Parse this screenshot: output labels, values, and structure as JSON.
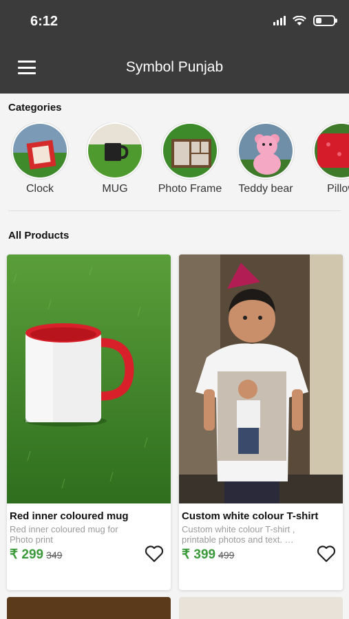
{
  "status_bar": {
    "time": "6:12"
  },
  "app_bar": {
    "title": "Symbol Punjab"
  },
  "categories_section": {
    "title": "Categories",
    "items": [
      {
        "label": "Clock"
      },
      {
        "label": "MUG"
      },
      {
        "label": "Photo Frame"
      },
      {
        "label": "Teddy bear"
      },
      {
        "label": "Pillow"
      }
    ]
  },
  "products_section": {
    "title": "All Products",
    "products": [
      {
        "name": "Red inner coloured mug",
        "description": "Red inner coloured mug for Photo print",
        "currency": "₹",
        "price": "299",
        "mrp": "349"
      },
      {
        "name": "Custom white colour T-shirt",
        "description": "Custom white colour T-shirt , printable photos and text. …",
        "currency": "₹",
        "price": "399",
        "mrp": "499"
      }
    ]
  },
  "colors": {
    "app_bar": "#3b3b3b",
    "price_green": "#3a9a3a",
    "background": "#f4f4f4"
  }
}
